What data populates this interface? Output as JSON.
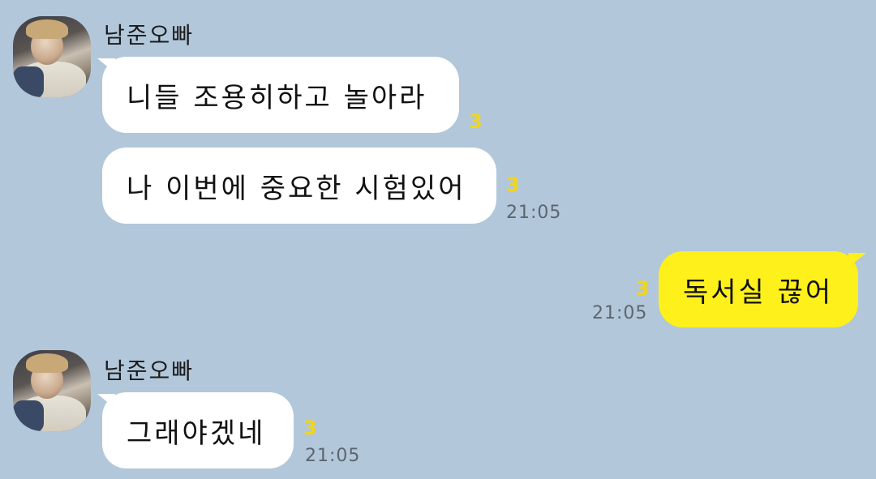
{
  "messages": [
    {
      "sender": "남준오빠",
      "bubbles": [
        {
          "text": "니들 조용히하고 놀아라",
          "unread": "3"
        },
        {
          "text": "나 이번에 중요한 시험있어",
          "unread": "3",
          "time": "21:05"
        }
      ]
    },
    {
      "sender": "me",
      "bubbles": [
        {
          "text": "독서실 끊어",
          "unread": "3",
          "time": "21:05"
        }
      ]
    },
    {
      "sender": "남준오빠",
      "bubbles": [
        {
          "text": "그래야겠네",
          "unread": "3",
          "time": "21:05"
        }
      ]
    }
  ],
  "colors": {
    "background": "#b2c7da",
    "incoming_bubble": "#ffffff",
    "outgoing_bubble": "#fef01b",
    "unread_count": "#f2d51a",
    "timestamp": "#5d6670"
  }
}
